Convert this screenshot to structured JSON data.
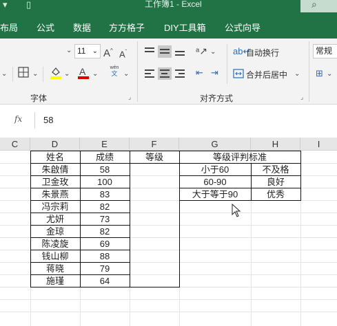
{
  "window": {
    "title": "工作簿1 - Excel",
    "search_glyph": "⌕",
    "qa_save": "▯",
    "qa_undo": "▾"
  },
  "tabs": [
    "布局",
    "公式",
    "数据",
    "方方格子",
    "DIY工具箱",
    "公式向导"
  ],
  "ribbon": {
    "font_size": "11",
    "font_grow": "A",
    "font_shrink": "A",
    "phonetic": "wén",
    "phonetic_sub": "文",
    "wrap_text": "自动换行",
    "merge_center": "合并后居中",
    "number_format": "常规",
    "group_font": "字体",
    "group_align": "对齐方式"
  },
  "formula_bar": {
    "fx_label": "fx",
    "value": "58"
  },
  "grid": {
    "columns": [
      "C",
      "D",
      "E",
      "F",
      "G",
      "H",
      "I"
    ],
    "header_row": {
      "name": "姓名",
      "score": "成绩",
      "grade": "等级",
      "criteria": "等级评判标准"
    },
    "students": [
      {
        "name": "朱啟倩",
        "score": "58"
      },
      {
        "name": "卫金玫",
        "score": "100"
      },
      {
        "name": "朱景燕",
        "score": "83"
      },
      {
        "name": "冯宗莉",
        "score": "82"
      },
      {
        "name": "尤妍",
        "score": "73"
      },
      {
        "name": "金琼",
        "score": "82"
      },
      {
        "name": "陈凌旋",
        "score": "69"
      },
      {
        "name": "钱山柳",
        "score": "88"
      },
      {
        "name": "蒋晓",
        "score": "79"
      },
      {
        "name": "施瑾",
        "score": "64"
      }
    ],
    "criteria": [
      {
        "range": "小于60",
        "grade": "不及格"
      },
      {
        "range": "60-90",
        "grade": "良好"
      },
      {
        "range": "大于等于90",
        "grade": "优秀"
      }
    ]
  }
}
